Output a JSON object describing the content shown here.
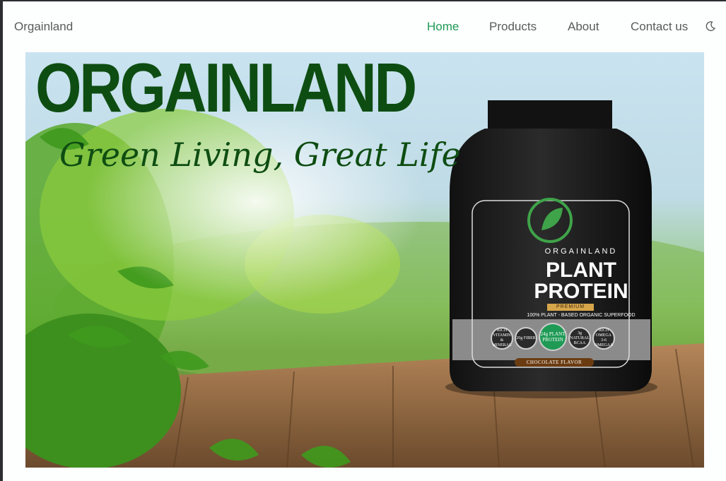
{
  "header": {
    "brand": "Orgainland",
    "nav": [
      "Home",
      "Products",
      "About",
      "Contact us"
    ],
    "active": "Home",
    "theme_icon": "moon-icon"
  },
  "hero": {
    "title": "ORGAINLAND",
    "tagline": "Green Living, Great Life",
    "product": {
      "brand": "ORGAINLAND",
      "title_line1": "PLANT",
      "title_line2": "PROTEIN",
      "premium": "PREMIUM",
      "subtitle": "100% PLANT - BASED ORGANIC SUPERFOOD",
      "badges": [
        "RICH VITAMIN & MINERAL",
        "20g FIBER",
        "24g PLANT PROTEIN",
        "3g NATURAL BCAA",
        "RICH OMEGA 3-6 OMEGA 9"
      ],
      "flavor": "CHOCOLATE FLAVOR"
    }
  },
  "colors": {
    "accent": "#1f9a55",
    "nav_text": "#5a5a5a",
    "title_green": "#0e4d12"
  }
}
